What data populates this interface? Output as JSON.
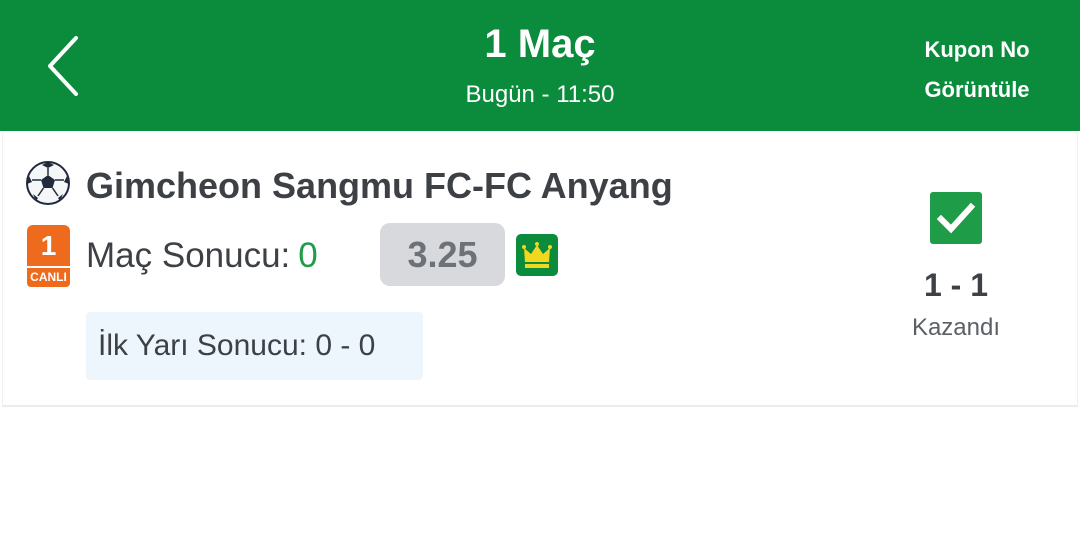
{
  "header": {
    "title": "1 Maç",
    "subtitle": "Bugün - 11:50",
    "coupon_line1": "Kupon No",
    "coupon_line2": "Görüntüle",
    "background_color": "#0a8c3c"
  },
  "bet": {
    "sport_icon": "soccer-ball-icon",
    "match_name": "Gimcheon Sangmu FC-FC Anyang",
    "live_badge_number": "1",
    "live_badge_label": "CANLI",
    "market_label": "Maç Sonucu:",
    "pick": "0",
    "odds": "3.25",
    "crown_icon": "crown-icon",
    "half_time_result": "İlk Yarı Sonucu: 0 - 0",
    "result_icon": "check-icon",
    "score": "1 - 1",
    "status": "Kazandı",
    "accent_color": "#1e9c47",
    "live_color": "#ee6a1c"
  }
}
